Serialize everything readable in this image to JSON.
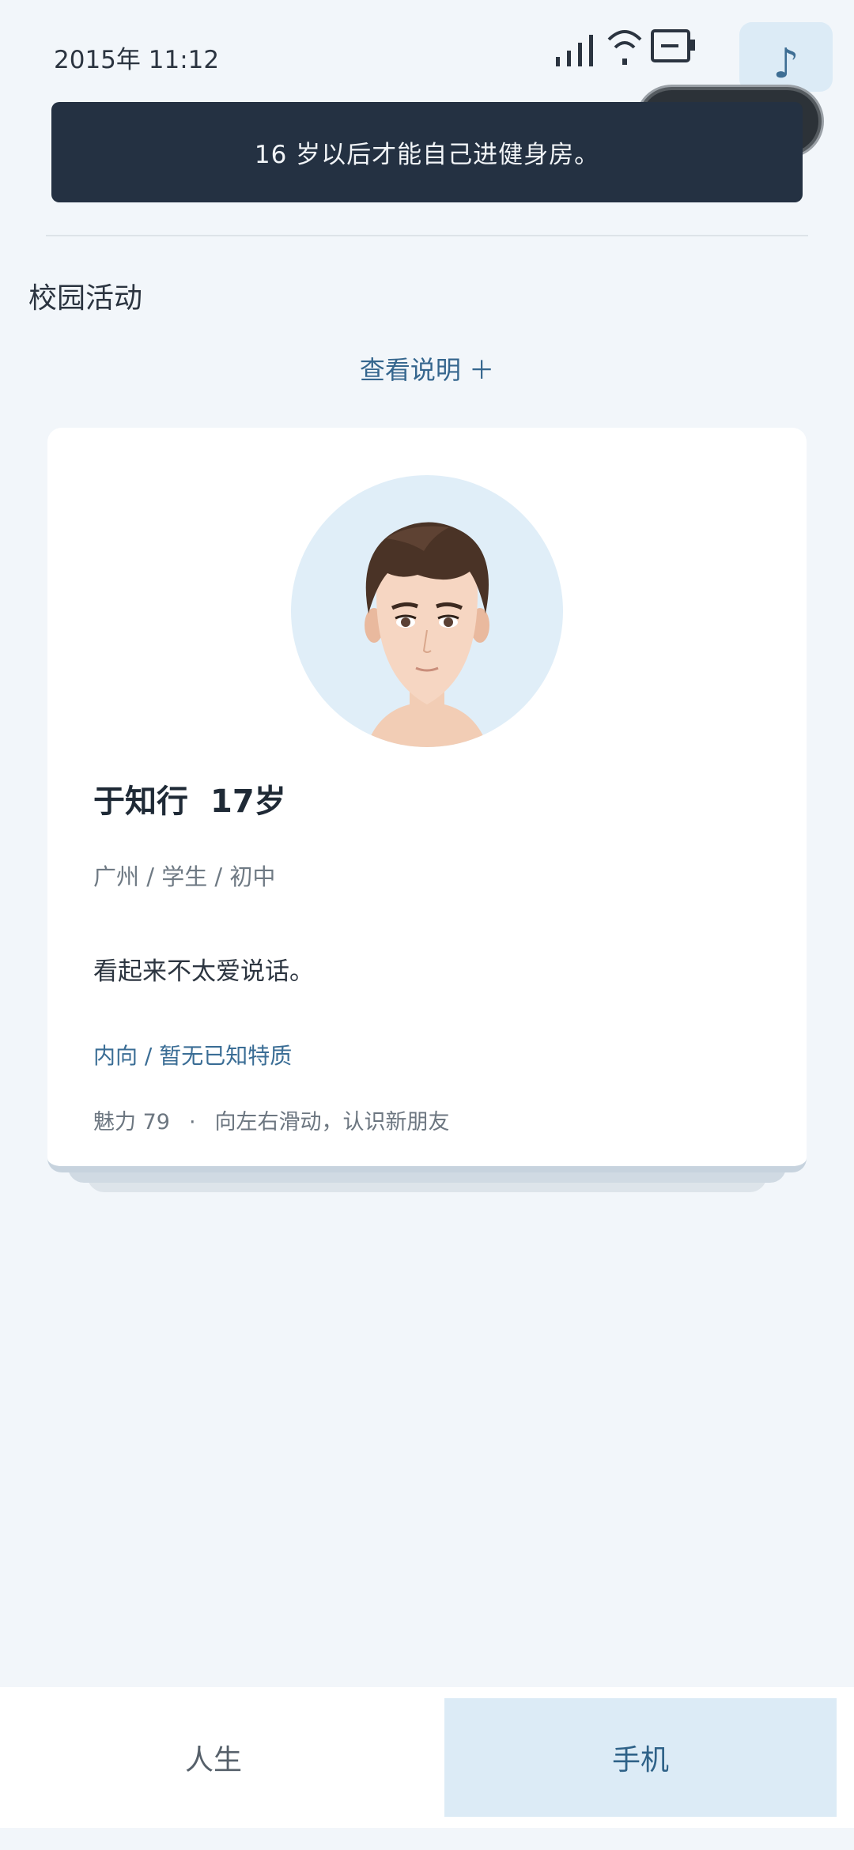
{
  "status_bar": {
    "time": "2015年 11:12",
    "icons": [
      "signal-icon",
      "wifi-icon",
      "battery-icon"
    ]
  },
  "music_button": {
    "icon": "music-note-icon",
    "glyph": "♪"
  },
  "capsule": {
    "icons": [
      "more-dots-icon",
      "close-circle-icon"
    ]
  },
  "notice": {
    "text": "16 岁以后才能自己进健身房。"
  },
  "section": {
    "title": "校园活动"
  },
  "instructions": {
    "label": "查看说明 ＋"
  },
  "profile": {
    "name": "于知行",
    "age": "17岁",
    "location": "广州 / 学生 / 初中",
    "description": "看起来不太爱说话。",
    "traits": "内向 / 暂无已知特质",
    "charm_label": "魅力 79",
    "separator": "·",
    "hint": "向左右滑动，认识新朋友"
  },
  "tabs": [
    {
      "label": "人生",
      "active": false
    },
    {
      "label": "手机",
      "active": true
    }
  ],
  "colors": {
    "background": "#f2f6fa",
    "banner": "#243142",
    "accent": "#35668e",
    "active_tab": "#dcebf6"
  }
}
